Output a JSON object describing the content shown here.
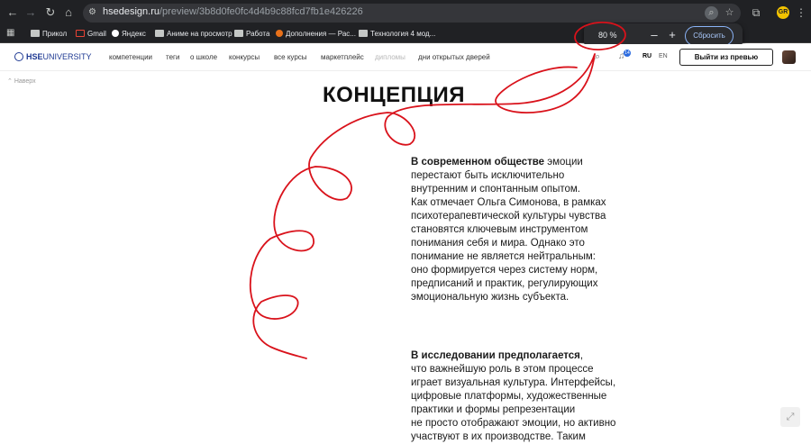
{
  "browser": {
    "url_host": "hsedesign.ru",
    "url_path": "/preview/3b8d0fe0fc4d4b9c88fcd7fb1e426226",
    "profile_initials": "GR"
  },
  "bookmarks": [
    {
      "label": "Прикол",
      "icon": "folder-icon"
    },
    {
      "label": "Gmail",
      "icon": "gmail-icon"
    },
    {
      "label": "Яндекс",
      "icon": "yandex-icon"
    },
    {
      "label": "Аниме на просмотр",
      "icon": "folder-icon"
    },
    {
      "label": "Работа",
      "icon": "folder-icon"
    },
    {
      "label": "Дополнения — Рас...",
      "icon": "addon-icon"
    },
    {
      "label": "Технология 4 мод...",
      "icon": "folder-icon"
    }
  ],
  "zoom_popup": {
    "value": "80 %",
    "minus": "–",
    "plus": "+",
    "reset_label": "Сбросить"
  },
  "site": {
    "logo_bold": "HSE",
    "logo_thin": "UNIVERSITY",
    "nav": [
      "компетенции",
      "теги",
      "о школе",
      "конкурсы",
      "все курсы",
      "маркетплейс",
      "дипломы",
      "дни открытых дверей"
    ],
    "notifications": "14",
    "lang_ru": "RU",
    "lang_en": "EN",
    "exit_preview": "Выйти из превью"
  },
  "content": {
    "back_link": "Наверх",
    "title": "КОНЦЕПЦИЯ",
    "para1_bold": "В современном обществе",
    "para1_lines": [
      " эмоции",
      "перестают быть исключительно",
      "внутренним и спонтанным опытом.",
      "Как отмечает Ольга Симонова, в рамках",
      "психотерапевтической культуры чувства",
      "становятся ключевым инструментом",
      "понимания себя и мира. Однако это",
      "понимание не является нейтральным:",
      "оно формируется через систему норм,",
      "предписаний и практик, регулирующих",
      "эмоциональную жизнь субъекта."
    ],
    "para2_bold": "В исследовании предполагается",
    "para2_lines": [
      ",",
      "что важнейшую роль в этом процессе",
      "играет визуальная культура. Интерфейсы,",
      "цифровые платформы, художественные",
      "практики и формы репрезентации",
      "не просто отображают эмоции, но активно",
      "участвуют в их производстве. Таким"
    ]
  },
  "colors": {
    "chrome_bg": "#202124",
    "omnibox_bg": "#35363a",
    "annotation_red": "#d9121b",
    "accent_blue": "#8ab4f8"
  }
}
